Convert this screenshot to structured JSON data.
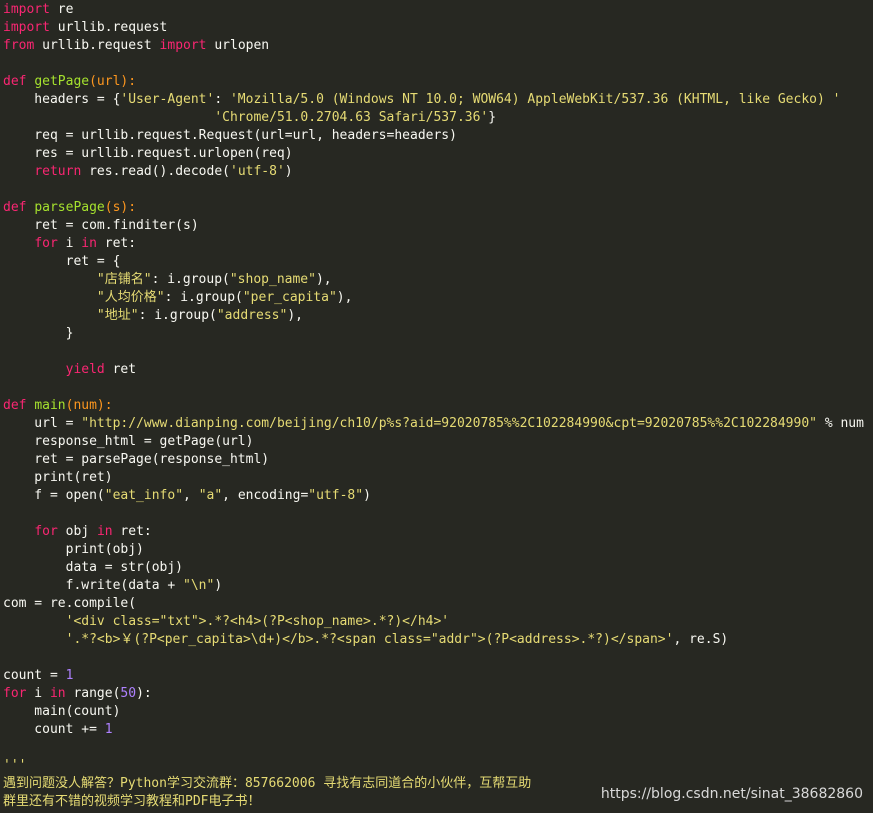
{
  "code": [
    {
      "segments": [
        {
          "t": "import",
          "c": "kw"
        },
        {
          "t": " re",
          "c": "plain"
        }
      ]
    },
    {
      "segments": [
        {
          "t": "import",
          "c": "kw"
        },
        {
          "t": " urllib.request",
          "c": "plain"
        }
      ]
    },
    {
      "segments": [
        {
          "t": "from",
          "c": "kw"
        },
        {
          "t": " urllib.request ",
          "c": "plain"
        },
        {
          "t": "import",
          "c": "kw"
        },
        {
          "t": " urlopen",
          "c": "plain"
        }
      ]
    },
    {
      "segments": []
    },
    {
      "segments": [
        {
          "t": "def",
          "c": "kw"
        },
        {
          "t": " ",
          "c": "plain"
        },
        {
          "t": "getPage",
          "c": "fn"
        },
        {
          "t": "(url):",
          "c": "param"
        }
      ]
    },
    {
      "segments": [
        {
          "t": "    headers = {",
          "c": "plain"
        },
        {
          "t": "'User-Agent'",
          "c": "str"
        },
        {
          "t": ": ",
          "c": "plain"
        },
        {
          "t": "'Mozilla/5.0 (Windows NT 10.0; WOW64) AppleWebKit/537.36 (KHTML, like Gecko) '",
          "c": "str"
        }
      ]
    },
    {
      "segments": [
        {
          "t": "                           ",
          "c": "plain"
        },
        {
          "t": "'Chrome/51.0.2704.63 Safari/537.36'",
          "c": "str"
        },
        {
          "t": "}",
          "c": "plain"
        }
      ]
    },
    {
      "segments": [
        {
          "t": "    req = urllib.request.Request(url=url, headers=headers)",
          "c": "plain"
        }
      ]
    },
    {
      "segments": [
        {
          "t": "    res = urllib.request.urlopen(req)",
          "c": "plain"
        }
      ]
    },
    {
      "segments": [
        {
          "t": "    ",
          "c": "plain"
        },
        {
          "t": "return",
          "c": "kw"
        },
        {
          "t": " res.read().decode(",
          "c": "plain"
        },
        {
          "t": "'utf-8'",
          "c": "str"
        },
        {
          "t": ")",
          "c": "plain"
        }
      ]
    },
    {
      "segments": []
    },
    {
      "segments": [
        {
          "t": "def",
          "c": "kw"
        },
        {
          "t": " ",
          "c": "plain"
        },
        {
          "t": "parsePage",
          "c": "fn"
        },
        {
          "t": "(s):",
          "c": "param"
        }
      ]
    },
    {
      "segments": [
        {
          "t": "    ret = com.finditer(s)",
          "c": "plain"
        }
      ]
    },
    {
      "segments": [
        {
          "t": "    ",
          "c": "plain"
        },
        {
          "t": "for",
          "c": "kw"
        },
        {
          "t": " i ",
          "c": "plain"
        },
        {
          "t": "in",
          "c": "kw"
        },
        {
          "t": " ret:",
          "c": "plain"
        }
      ]
    },
    {
      "segments": [
        {
          "t": "        ret = {",
          "c": "plain"
        }
      ]
    },
    {
      "segments": [
        {
          "t": "            ",
          "c": "plain"
        },
        {
          "t": "\"店铺名\"",
          "c": "str"
        },
        {
          "t": ": i.group(",
          "c": "plain"
        },
        {
          "t": "\"shop_name\"",
          "c": "str"
        },
        {
          "t": "),",
          "c": "plain"
        }
      ]
    },
    {
      "segments": [
        {
          "t": "            ",
          "c": "plain"
        },
        {
          "t": "\"人均价格\"",
          "c": "str"
        },
        {
          "t": ": i.group(",
          "c": "plain"
        },
        {
          "t": "\"per_capita\"",
          "c": "str"
        },
        {
          "t": "),",
          "c": "plain"
        }
      ]
    },
    {
      "segments": [
        {
          "t": "            ",
          "c": "plain"
        },
        {
          "t": "\"地址\"",
          "c": "str"
        },
        {
          "t": ": i.group(",
          "c": "plain"
        },
        {
          "t": "\"address\"",
          "c": "str"
        },
        {
          "t": "),",
          "c": "plain"
        }
      ]
    },
    {
      "segments": [
        {
          "t": "        }",
          "c": "plain"
        }
      ]
    },
    {
      "segments": []
    },
    {
      "segments": [
        {
          "t": "        ",
          "c": "plain"
        },
        {
          "t": "yield",
          "c": "kw"
        },
        {
          "t": " ret",
          "c": "plain"
        }
      ]
    },
    {
      "segments": []
    },
    {
      "segments": [
        {
          "t": "def",
          "c": "kw"
        },
        {
          "t": " ",
          "c": "plain"
        },
        {
          "t": "main",
          "c": "fn"
        },
        {
          "t": "(num):",
          "c": "param"
        }
      ]
    },
    {
      "segments": [
        {
          "t": "    url = ",
          "c": "plain"
        },
        {
          "t": "\"http://www.dianping.com/beijing/ch10/p%s?aid=92020785%%2C102284990&cpt=92020785%%2C102284990\"",
          "c": "str"
        },
        {
          "t": " % num",
          "c": "plain"
        }
      ]
    },
    {
      "segments": [
        {
          "t": "    response_html = getPage(url)",
          "c": "plain"
        }
      ]
    },
    {
      "segments": [
        {
          "t": "    ret = parsePage(response_html)",
          "c": "plain"
        }
      ]
    },
    {
      "segments": [
        {
          "t": "    print(ret)",
          "c": "plain"
        }
      ]
    },
    {
      "segments": [
        {
          "t": "    f = open(",
          "c": "plain"
        },
        {
          "t": "\"eat_info\"",
          "c": "str"
        },
        {
          "t": ", ",
          "c": "plain"
        },
        {
          "t": "\"a\"",
          "c": "str"
        },
        {
          "t": ", encoding=",
          "c": "plain"
        },
        {
          "t": "\"utf-8\"",
          "c": "str"
        },
        {
          "t": ")",
          "c": "plain"
        }
      ]
    },
    {
      "segments": []
    },
    {
      "segments": [
        {
          "t": "    ",
          "c": "plain"
        },
        {
          "t": "for",
          "c": "kw"
        },
        {
          "t": " obj ",
          "c": "plain"
        },
        {
          "t": "in",
          "c": "kw"
        },
        {
          "t": " ret:",
          "c": "plain"
        }
      ]
    },
    {
      "segments": [
        {
          "t": "        print(obj)",
          "c": "plain"
        }
      ]
    },
    {
      "segments": [
        {
          "t": "        data = str(obj)",
          "c": "plain"
        }
      ]
    },
    {
      "segments": [
        {
          "t": "        f.write(data + ",
          "c": "plain"
        },
        {
          "t": "\"\\n\"",
          "c": "str"
        },
        {
          "t": ")",
          "c": "plain"
        }
      ]
    },
    {
      "segments": [
        {
          "t": "com = re.compile(",
          "c": "plain"
        }
      ]
    },
    {
      "segments": [
        {
          "t": "        ",
          "c": "plain"
        },
        {
          "t": "'<div class=\"txt\">.*?<h4>(?P<shop_name>.*?)</h4>'",
          "c": "str"
        }
      ]
    },
    {
      "segments": [
        {
          "t": "        ",
          "c": "plain"
        },
        {
          "t": "'.*?<b>￥(?P<per_capita>\\d+)</b>.*?<span class=\"addr\">(?P<address>.*?)</span>'",
          "c": "str"
        },
        {
          "t": ", re.S)",
          "c": "plain"
        }
      ]
    },
    {
      "segments": []
    },
    {
      "segments": [
        {
          "t": "count = ",
          "c": "plain"
        },
        {
          "t": "1",
          "c": "num"
        }
      ]
    },
    {
      "segments": [
        {
          "t": "for",
          "c": "kw"
        },
        {
          "t": " i ",
          "c": "plain"
        },
        {
          "t": "in",
          "c": "kw"
        },
        {
          "t": " range(",
          "c": "plain"
        },
        {
          "t": "50",
          "c": "num"
        },
        {
          "t": "):",
          "c": "plain"
        }
      ]
    },
    {
      "segments": [
        {
          "t": "    main(count)",
          "c": "plain"
        }
      ]
    },
    {
      "segments": [
        {
          "t": "    count += ",
          "c": "plain"
        },
        {
          "t": "1",
          "c": "num"
        }
      ]
    },
    {
      "segments": []
    },
    {
      "segments": [
        {
          "t": "'''",
          "c": "str"
        }
      ]
    },
    {
      "segments": [
        {
          "t": "遇到问题没人解答？Python学习交流群：857662006 寻找有志同道合的小伙伴，互帮互助",
          "c": "str"
        }
      ]
    },
    {
      "segments": [
        {
          "t": "群里还有不错的视频学习教程和PDF电子书！",
          "c": "str"
        }
      ]
    }
  ],
  "watermark": "https://blog.csdn.net/sinat_38682860"
}
